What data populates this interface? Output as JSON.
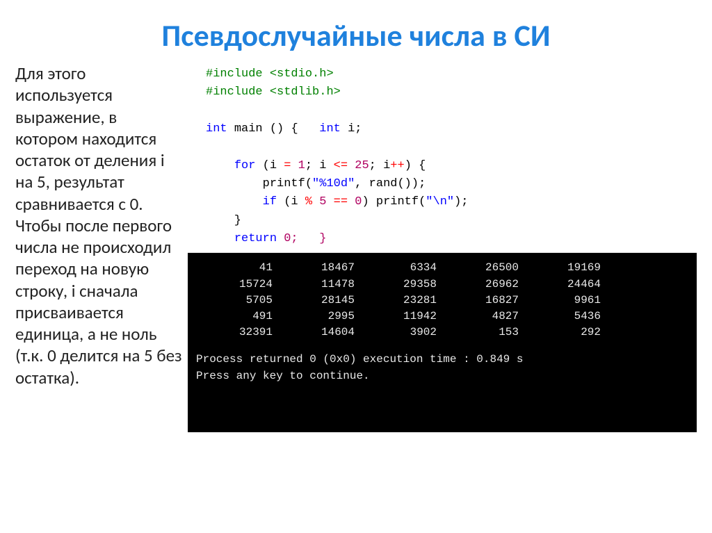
{
  "title": "Псевдослучайные числа в СИ",
  "paragraph": "Для этого используется выражение, в котором находится остаток от деления i на 5, результат сравнивается с 0. Чтобы после первого числа не происходил переход на новую строку, i сначала присваивается единица, а не ноль (т.к. 0 делится на 5 без остатка).",
  "code": {
    "line1a": "#include ",
    "line1b": "<stdio.h>",
    "line2a": "#include ",
    "line2b": "<stdlib.h>",
    "kw_int": "int",
    "fn_main": "main",
    "paren_open": "(",
    "paren_close": ")",
    "brace_open": "{",
    "brace_close": "}",
    "int_decl_i": "int i;",
    "kw_for": "for",
    "for_a": "(i ",
    "for_assign": "=",
    "for_1": " 1",
    "for_sep1": "; i ",
    "for_le": "<=",
    "for_25": " 25",
    "for_sep2": "; i",
    "for_inc": "++",
    "for_end": ") {",
    "printf1": "printf(",
    "fmt1a": "\"",
    "fmt1b": "%10d",
    "fmt1c": "\"",
    "printf1b": ", rand());",
    "kw_if": "if",
    "if_open": " (i ",
    "mod_op": "%",
    "mod_5": " 5 ",
    "eq_op": "==",
    "eq_0": " 0",
    "if_close": ") printf(",
    "fmt2a": "\"",
    "fmt2b": "\\n",
    "fmt2c": "\"",
    "if_end": ");",
    "close_brace1": "    }",
    "return_kw": "return",
    "return_rest": " 0;   }"
  },
  "output_rows": [
    [
      "41",
      "18467",
      "6334",
      "26500",
      "19169"
    ],
    [
      "15724",
      "11478",
      "29358",
      "26962",
      "24464"
    ],
    [
      "5705",
      "28145",
      "23281",
      "16827",
      "9961"
    ],
    [
      "491",
      "2995",
      "11942",
      "4827",
      "5436"
    ],
    [
      "32391",
      "14604",
      "3902",
      "153",
      "292"
    ]
  ],
  "console_status1": "Process returned 0 (0x0)   execution time : 0.849 s",
  "console_status2": "Press any key to continue."
}
